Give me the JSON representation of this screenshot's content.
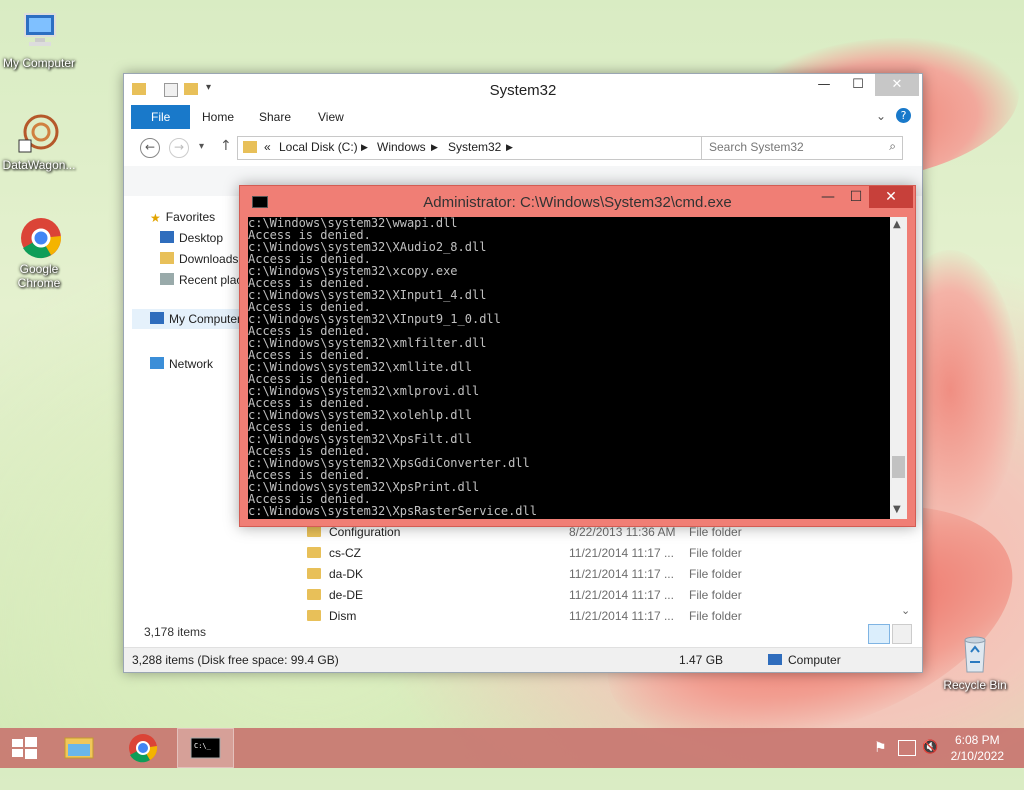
{
  "desktop": {
    "icons": [
      {
        "label": "My Computer"
      },
      {
        "label": "DataWagon..."
      },
      {
        "label": "Google Chrome"
      },
      {
        "label": "Recycle Bin"
      }
    ]
  },
  "explorer": {
    "title": "System32",
    "ribbon_tabs": [
      "File",
      "Home",
      "Share",
      "View"
    ],
    "address": {
      "prefix": "«",
      "crumbs": [
        "Local Disk (C:)",
        "Windows",
        "System32"
      ]
    },
    "search_placeholder": "Search System32",
    "nav": {
      "favorites": "Favorites",
      "desktop": "Desktop",
      "downloads": "Downloads",
      "recent": "Recent places",
      "computer": "My Computer",
      "network": "Network"
    },
    "files": [
      {
        "name": "Configuration",
        "date": "8/22/2013 11:36 AM",
        "type": "File folder"
      },
      {
        "name": "cs-CZ",
        "date": "11/21/2014 11:17 ...",
        "type": "File folder"
      },
      {
        "name": "da-DK",
        "date": "11/21/2014 11:17 ...",
        "type": "File folder"
      },
      {
        "name": "de-DE",
        "date": "11/21/2014 11:17 ...",
        "type": "File folder"
      },
      {
        "name": "Dism",
        "date": "11/21/2014 11:17 ...",
        "type": "File folder"
      }
    ],
    "item_count": "3,178 items",
    "status": {
      "items": "3,288 items (Disk free space: 99.4 GB)",
      "size": "1.47 GB",
      "location": "Computer"
    }
  },
  "cmd": {
    "title": "Administrator: C:\\Windows\\System32\\cmd.exe",
    "lines": [
      "c:\\Windows\\system32\\wwapi.dll",
      "Access is denied.",
      "c:\\Windows\\system32\\XAudio2_8.dll",
      "Access is denied.",
      "c:\\Windows\\system32\\xcopy.exe",
      "Access is denied.",
      "c:\\Windows\\system32\\XInput1_4.dll",
      "Access is denied.",
      "c:\\Windows\\system32\\XInput9_1_0.dll",
      "Access is denied.",
      "c:\\Windows\\system32\\xmlfilter.dll",
      "Access is denied.",
      "c:\\Windows\\system32\\xmllite.dll",
      "Access is denied.",
      "c:\\Windows\\system32\\xmlprovi.dll",
      "Access is denied.",
      "c:\\Windows\\system32\\xolehlp.dll",
      "Access is denied.",
      "c:\\Windows\\system32\\XpsFilt.dll",
      "Access is denied.",
      "c:\\Windows\\system32\\XpsGdiConverter.dll",
      "Access is denied.",
      "c:\\Windows\\system32\\XpsPrint.dll",
      "Access is denied.",
      "c:\\Windows\\system32\\XpsRasterService.dll"
    ]
  },
  "taskbar": {
    "time": "6:08 PM",
    "date": "2/10/2022"
  }
}
